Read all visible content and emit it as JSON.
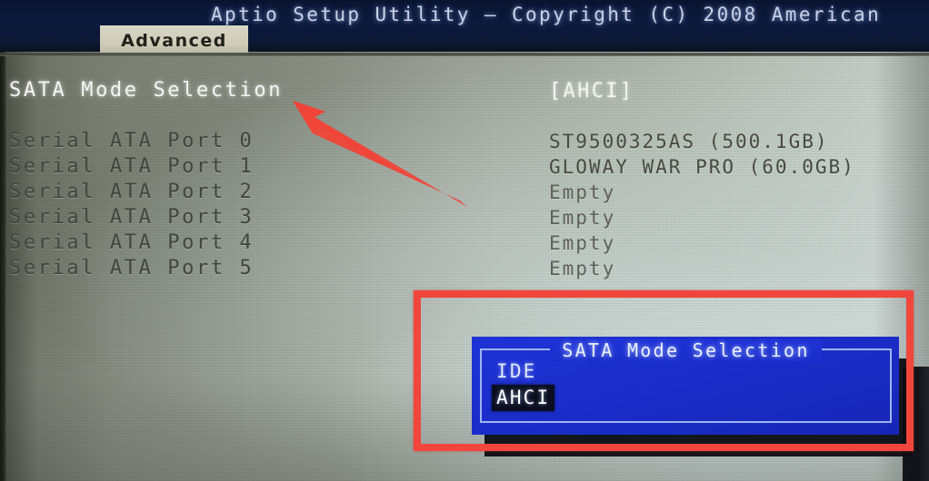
{
  "header": {
    "title": "Aptio Setup Utility – Copyright (C) 2008 American",
    "active_tab": "Advanced",
    "banner_color": "#0d1a3c",
    "tab_color": "#d0cdb9"
  },
  "settings": {
    "selected_label": "SATA Mode Selection",
    "selected_value": "[AHCI]",
    "ports": [
      {
        "label": "Serial ATA Port 0",
        "value": "ST9500325AS     (500.1GB)"
      },
      {
        "label": "Serial ATA Port 1",
        "value": "GLOWAY WAR PRO (60.0GB)"
      },
      {
        "label": "Serial ATA Port 2",
        "value": "Empty"
      },
      {
        "label": "Serial ATA Port 3",
        "value": "Empty"
      },
      {
        "label": "Serial ATA Port 4",
        "value": "Empty"
      },
      {
        "label": "Serial ATA Port 5",
        "value": "Empty"
      }
    ]
  },
  "dialog": {
    "title": "SATA Mode Selection",
    "options": [
      {
        "label": "IDE",
        "selected": false
      },
      {
        "label": "AHCI",
        "selected": true
      }
    ],
    "background_color": "#1b2ecb",
    "border_color": "#9fb4f2",
    "highlight_color": "#0a0e20"
  },
  "annotations": {
    "highlight_color": "#f0463c",
    "arrow_target": "SATA Mode Selection",
    "rect_target": "SATA Mode Selection dialog"
  }
}
